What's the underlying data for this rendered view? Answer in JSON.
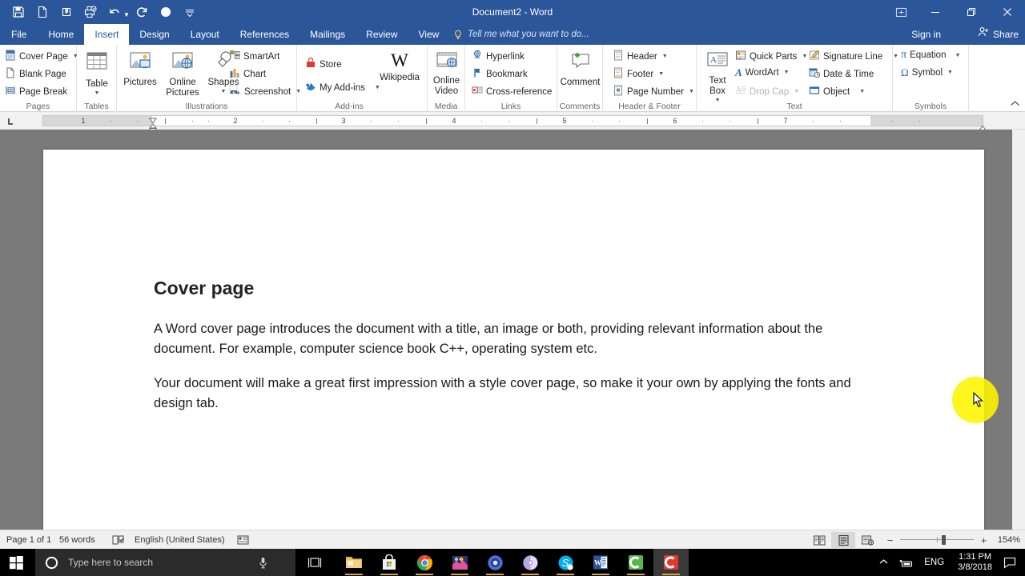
{
  "window": {
    "title": "Document2 - Word",
    "quick_access": [
      {
        "name": "save-icon",
        "label": "Save"
      },
      {
        "name": "new-document-icon",
        "label": "New"
      },
      {
        "name": "touch-mode-icon",
        "label": "Touch/Mouse Mode"
      },
      {
        "name": "print-preview-icon",
        "label": "Print Preview and Print"
      },
      {
        "name": "undo-icon",
        "label": "Undo"
      },
      {
        "name": "redo-icon",
        "label": "Redo"
      },
      {
        "name": "record-icon",
        "label": "Record"
      },
      {
        "name": "customize-qat-icon",
        "label": "Customize Quick Access Toolbar"
      }
    ],
    "controls": {
      "ribbon_display": "Ribbon Display Options",
      "minimize": "Minimize",
      "restore": "Restore Down",
      "close": "Close"
    }
  },
  "tabs": [
    {
      "label": "File",
      "active": false
    },
    {
      "label": "Home",
      "active": false
    },
    {
      "label": "Insert",
      "active": true
    },
    {
      "label": "Design",
      "active": false
    },
    {
      "label": "Layout",
      "active": false
    },
    {
      "label": "References",
      "active": false
    },
    {
      "label": "Mailings",
      "active": false
    },
    {
      "label": "Review",
      "active": false
    },
    {
      "label": "View",
      "active": false
    }
  ],
  "tell_me": "Tell me what you want to do...",
  "account": {
    "sign_in": "Sign in",
    "share": "Share"
  },
  "ribbon": {
    "collapse_label": "Collapse the Ribbon",
    "groups": [
      {
        "name": "Pages",
        "items": [
          {
            "label": "Cover Page",
            "dropdown": true,
            "disabled": false
          },
          {
            "label": "Blank Page",
            "dropdown": false,
            "disabled": false
          },
          {
            "label": "Page Break",
            "dropdown": false,
            "disabled": false
          }
        ]
      },
      {
        "name": "Tables",
        "items": [
          {
            "label": "Table",
            "dropdown": true,
            "disabled": false
          }
        ]
      },
      {
        "name": "Illustrations",
        "items": [
          {
            "label": "Pictures",
            "dropdown": false,
            "disabled": false
          },
          {
            "label": "Online Pictures",
            "dropdown": false,
            "disabled": false
          },
          {
            "label": "Shapes",
            "dropdown": true,
            "disabled": false
          },
          {
            "label": "SmartArt",
            "dropdown": false,
            "disabled": false
          },
          {
            "label": "Chart",
            "dropdown": false,
            "disabled": false
          },
          {
            "label": "Screenshot",
            "dropdown": true,
            "disabled": false
          }
        ]
      },
      {
        "name": "Add-ins",
        "items": [
          {
            "label": "Store",
            "dropdown": false,
            "disabled": false
          },
          {
            "label": "My Add-ins",
            "dropdown": true,
            "disabled": false
          },
          {
            "label": "Wikipedia",
            "dropdown": false,
            "disabled": false
          }
        ]
      },
      {
        "name": "Media",
        "items": [
          {
            "label": "Online Video",
            "dropdown": false,
            "disabled": false
          }
        ]
      },
      {
        "name": "Links",
        "items": [
          {
            "label": "Hyperlink",
            "dropdown": false,
            "disabled": false
          },
          {
            "label": "Bookmark",
            "dropdown": false,
            "disabled": false
          },
          {
            "label": "Cross-reference",
            "dropdown": false,
            "disabled": false
          }
        ]
      },
      {
        "name": "Comments",
        "items": [
          {
            "label": "Comment",
            "dropdown": false,
            "disabled": false
          }
        ]
      },
      {
        "name": "Header & Footer",
        "items": [
          {
            "label": "Header",
            "dropdown": true,
            "disabled": false
          },
          {
            "label": "Footer",
            "dropdown": true,
            "disabled": false
          },
          {
            "label": "Page Number",
            "dropdown": true,
            "disabled": false
          }
        ]
      },
      {
        "name": "Text",
        "items": [
          {
            "label": "Text Box",
            "dropdown": true,
            "disabled": false
          },
          {
            "label": "Quick Parts",
            "dropdown": true,
            "disabled": false
          },
          {
            "label": "WordArt",
            "dropdown": true,
            "disabled": false
          },
          {
            "label": "Drop Cap",
            "dropdown": true,
            "disabled": true
          },
          {
            "label": "Signature Line",
            "dropdown": true,
            "disabled": false
          },
          {
            "label": "Date & Time",
            "dropdown": false,
            "disabled": false
          },
          {
            "label": "Object",
            "dropdown": true,
            "disabled": false
          }
        ]
      },
      {
        "name": "Symbols",
        "items": [
          {
            "label": "Equation",
            "dropdown": true,
            "disabled": false
          },
          {
            "label": "Symbol",
            "dropdown": true,
            "disabled": false
          }
        ]
      }
    ]
  },
  "ruler": {
    "numbers": [
      "1",
      "2",
      "3",
      "4",
      "5",
      "6",
      "7"
    ],
    "left_indent_inches": 1.0,
    "right_indent_inches": 6.4,
    "tab_stop_type": "left-tab"
  },
  "document": {
    "heading": "Cover page",
    "paragraph1": "A Word cover page introduces the document with a title, an image or both, providing relevant information about the document. For example, computer science book C++, operating system etc.",
    "paragraph2": "Your document will make a great first impression with a style cover page, so make it your own by applying the fonts and design tab."
  },
  "status_bar": {
    "page": "Page 1 of 1",
    "words": "56 words",
    "proofing_icon": "proofing-errors-icon",
    "language": "English (United States)",
    "macro_icon": "macro-record-icon",
    "views": [
      {
        "name": "read-mode-view",
        "selected": false
      },
      {
        "name": "print-layout-view",
        "selected": true
      },
      {
        "name": "web-layout-view",
        "selected": false
      }
    ],
    "zoom_out": "−",
    "zoom_in": "+",
    "zoom_value": "154%"
  },
  "taskbar": {
    "start": "Start",
    "search_placeholder": "Type here to search",
    "cortana_icon": "cortana-icon",
    "mic_icon": "microphone-icon",
    "task_view": "Task View",
    "apps": [
      {
        "name": "file-explorer-icon",
        "label": "File Explorer",
        "active": false
      },
      {
        "name": "microsoft-store-icon",
        "label": "Microsoft Store",
        "active": false
      },
      {
        "name": "google-chrome-icon",
        "label": "Google Chrome",
        "active": false
      },
      {
        "name": "photos-icon",
        "label": "Photos",
        "active": false
      },
      {
        "name": "browser-icon",
        "label": "Browser",
        "active": false
      },
      {
        "name": "bittorrent-icon",
        "label": "BitTorrent",
        "active": false
      },
      {
        "name": "skype-icon",
        "label": "Skype",
        "active": false
      },
      {
        "name": "word-icon",
        "label": "Word",
        "active": false
      },
      {
        "name": "camtasia-studio-icon",
        "label": "Camtasia Studio",
        "active": false
      },
      {
        "name": "camtasia-recorder-icon",
        "label": "Camtasia Recorder",
        "active": true
      }
    ],
    "tray": {
      "show_hidden": "Show hidden icons",
      "network_icon": "network-icon",
      "language": "ENG",
      "time": "1:31 PM",
      "date": "3/8/2018",
      "action_center": "Action Center"
    }
  },
  "colors": {
    "word_blue": "#2b579a",
    "ribbon_bg": "#ffffff",
    "doc_bg": "#7a7a7a",
    "status_bg": "#f0f0f0",
    "taskbar_bg": "#000000",
    "highlight_yellow": "#fdf500"
  }
}
